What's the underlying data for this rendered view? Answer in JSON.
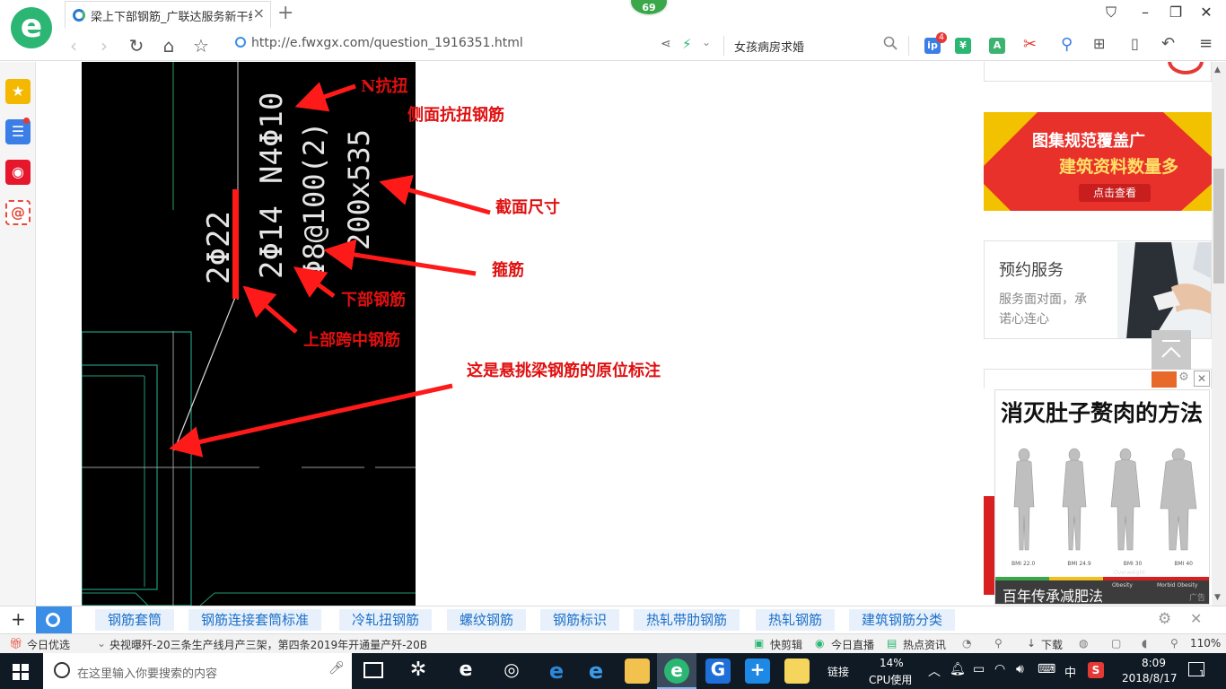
{
  "browser": {
    "tab_title": "梁上下部钢筋_广联达服务新干线",
    "new_tab": "+",
    "badge": "69",
    "url": "http://e.fwxgx.com/question_1916351.html",
    "search_query": "女孩病房求婚",
    "toolbar_badge": "4",
    "window_controls": [
      "minimize-icon",
      "maximize-icon",
      "close-icon"
    ]
  },
  "sidebar": {
    "items": [
      {
        "icon": "star-icon",
        "color": "#f5b800"
      },
      {
        "icon": "list-icon",
        "color": "#3a7ee6"
      },
      {
        "icon": "weibo-icon",
        "color": "#e6162d"
      },
      {
        "icon": "mail-icon",
        "color": "#e64b3c"
      }
    ]
  },
  "cad": {
    "labels": {
      "top_rebar": "2Φ22",
      "bottom_rebar": "2Φ14",
      "torsion": "N4Φ10",
      "stirrup": "Φ8@100(2)",
      "section": "200x535"
    },
    "annotations": {
      "n_torsion": "N抗扭",
      "side_torsion": "侧面抗扭钢筋",
      "section_size": "截面尺寸",
      "stirrup": "箍筋",
      "bottom_rebar": "下部钢筋",
      "mid_span_top": "上部跨中钢筋",
      "note": "这是悬挑梁钢筋的原位标注"
    }
  },
  "right_column": {
    "promo_banner": {
      "line1": "图集规范覆盖广",
      "line2": "建筑资料数量多",
      "button": "点击查看"
    },
    "service_card": {
      "title": "预约服务",
      "line1": "服务面对面，承",
      "line2": "诺心连心"
    },
    "back_to_top_icon": "back-to-top-icon"
  },
  "ad": {
    "headline": "消灭肚子赘肉的方法",
    "caption": "百年传承减肥法",
    "corner": "广告",
    "bmi_labels": [
      "BMI 22.0",
      "BMI 24.9",
      "BMI 30",
      "BMI 40"
    ],
    "bar_labels": [
      "Overweight",
      "Obesity",
      "Morbid Obesity"
    ]
  },
  "tags": {
    "items": [
      "钢筋套筒",
      "钢筋连接套筒标准",
      "冷轧扭钢筋",
      "螺纹钢筋",
      "钢筋标识",
      "热轧带肋钢筋",
      "热轧钢筋",
      "建筑钢筋分类"
    ]
  },
  "statusbar": {
    "today_pick": "今日优选",
    "news": "央视曝歼-20三条生产线月产三架，第四条2019年开通量产歼-20B",
    "quick_cut": "快剪辑",
    "live": "今日直播",
    "hot_news": "热点资讯",
    "download": "下载",
    "zoom": "110%"
  },
  "taskbar": {
    "search_placeholder": "在这里输入你要搜索的内容",
    "link": "链接",
    "cpu_percent": "14%",
    "cpu_label": "CPU使用",
    "ime": "中",
    "time": "8:09",
    "date": "2018/8/17",
    "notif_count": "1"
  }
}
